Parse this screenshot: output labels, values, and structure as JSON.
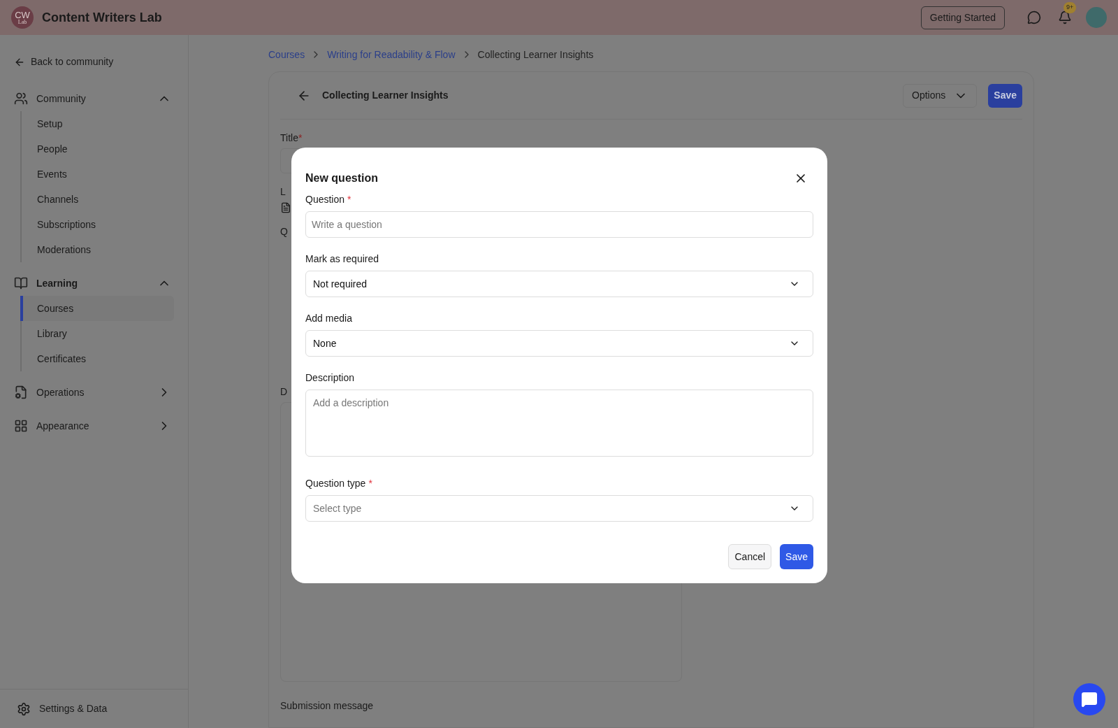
{
  "header": {
    "logo_initials": "CW",
    "logo_sub": "Lab",
    "title": "Content Writers Lab",
    "getting_started": "Getting Started",
    "notification_badge": "9+"
  },
  "sidebar": {
    "back": "Back to community",
    "sections": [
      {
        "label": "Community",
        "expanded": true,
        "items": [
          {
            "label": "Setup",
            "selected": false
          },
          {
            "label": "People",
            "selected": false
          },
          {
            "label": "Events",
            "selected": false
          },
          {
            "label": "Channels",
            "selected": false
          },
          {
            "label": "Subscriptions",
            "selected": false
          },
          {
            "label": "Moderations",
            "selected": false
          }
        ]
      },
      {
        "label": "Learning",
        "expanded": true,
        "items": [
          {
            "label": "Courses",
            "selected": true
          },
          {
            "label": "Library",
            "selected": false
          },
          {
            "label": "Certificates",
            "selected": false
          }
        ]
      },
      {
        "label": "Operations",
        "expanded": false
      },
      {
        "label": "Appearance",
        "expanded": false
      }
    ],
    "footer": "Settings & Data"
  },
  "breadcrumbs": [
    "Courses",
    "Writing for Readability & Flow",
    "Collecting Learner Insights"
  ],
  "page": {
    "title": "Collecting Learner Insights",
    "options": "Options",
    "save": "Save",
    "title_label": "Title",
    "title_required_mark": "*",
    "partial_labels": [
      "L",
      "Q",
      "D"
    ],
    "submission_label": "Submission message"
  },
  "dialog": {
    "title": "New question",
    "required_mark": "*",
    "fields": [
      {
        "kind": "input",
        "label": "Question",
        "required": true,
        "placeholder": "Write a question"
      },
      {
        "kind": "select",
        "label": "Mark as required",
        "required": false,
        "value": "Not required"
      },
      {
        "kind": "select",
        "label": "Add media",
        "required": false,
        "value": "None"
      },
      {
        "kind": "textarea",
        "label": "Description",
        "required": false,
        "placeholder": "Add a description"
      },
      {
        "kind": "select",
        "label": "Question type",
        "required": true,
        "placeholder": "Select type"
      }
    ],
    "cancel": "Cancel",
    "save": "Save"
  }
}
